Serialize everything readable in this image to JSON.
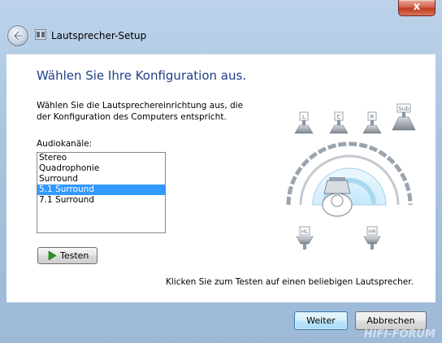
{
  "window": {
    "title": "Lautsprecher-Setup",
    "close_label": "x"
  },
  "main": {
    "heading": "Wählen Sie Ihre Konfiguration aus.",
    "description_line1": "Wählen Sie die Lautsprechereinrichtung aus, die",
    "description_line2": "der Konfiguration des Computers entspricht.",
    "list_label": "Audiokanäle:",
    "channels": [
      "Stereo",
      "Quadrophonie",
      "Surround",
      "5.1 Surround",
      "7.1 Surround"
    ],
    "selected_channel": "5.1 Surround",
    "test_label": "Testen",
    "hint": "Klicken Sie zum Testen auf einen beliebigen Lautsprecher."
  },
  "diagram": {
    "speakers": {
      "left": "L",
      "center": "C",
      "right": "R",
      "sub": "Sub",
      "rear_left": "HL",
      "rear_right": "HR"
    }
  },
  "footer": {
    "next_label": "Weiter",
    "cancel_label": "Abbrechen"
  },
  "watermark": "HIFI-FORUM",
  "colors": {
    "heading": "#1e3f8a",
    "selection": "#3399ff",
    "close": "#c13d24"
  },
  "icons": {
    "back": "back-arrow-icon",
    "app": "speaker-app-icon",
    "play": "play-icon"
  }
}
